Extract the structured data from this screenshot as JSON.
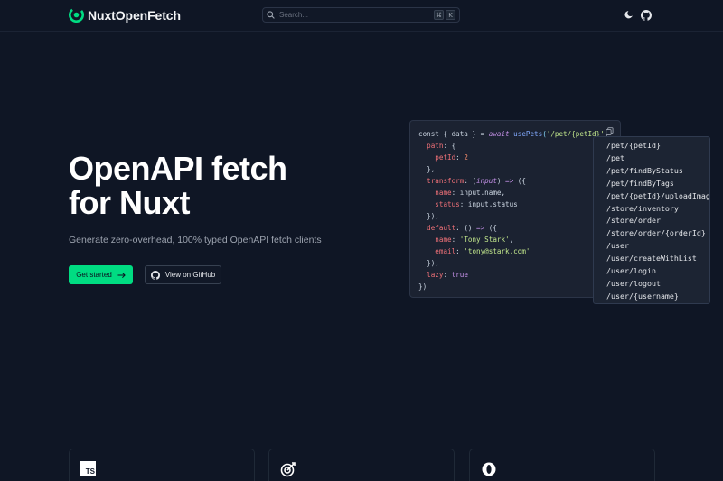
{
  "header": {
    "logo_text": "NuxtOpenFetch",
    "search_placeholder": "Search...",
    "shortcut_keys": [
      "⌘",
      "K"
    ],
    "theme_icon": "moon-icon",
    "github_icon": "github-icon",
    "brand_color": "#00dc82"
  },
  "hero": {
    "title_line1": "OpenAPI fetch",
    "title_line2": "for Nuxt",
    "subtitle": "Generate zero-overhead, 100% typed OpenAPI fetch clients",
    "primary_button": "Get started",
    "secondary_button": "View on GitHub"
  },
  "code": {
    "line1_pre": "const { data } = ",
    "line1_await": "await",
    "line1_fn": "usePets",
    "line1_str": "'/pet/{petId}'",
    "line2_key": "path",
    "line3_key": "petId",
    "line3_val": "2",
    "line5_key": "transform",
    "line5_param": "input",
    "line6_key": "name",
    "line6_val": "input.name,",
    "line7_key": "status",
    "line7_val": "input.status",
    "line9_key": "default",
    "line10_key": "name",
    "line10_val": "'Tony Stark'",
    "line11_key": "email",
    "line11_val": "'tony@stark.com'",
    "line13_key": "lazy",
    "line13_val": "true"
  },
  "autocomplete": [
    "/pet/{petId}",
    "/pet",
    "/pet/findByStatus",
    "/pet/findByTags",
    "/pet/{petId}/uploadImage",
    "/store/inventory",
    "/store/order",
    "/store/order/{orderId}",
    "/user",
    "/user/createWithList",
    "/user/login",
    "/user/logout",
    "/user/{username}"
  ],
  "cards": [
    {
      "icon": "typescript-icon",
      "badge": "TS"
    },
    {
      "icon": "target-icon"
    },
    {
      "icon": "openapi-icon"
    }
  ]
}
